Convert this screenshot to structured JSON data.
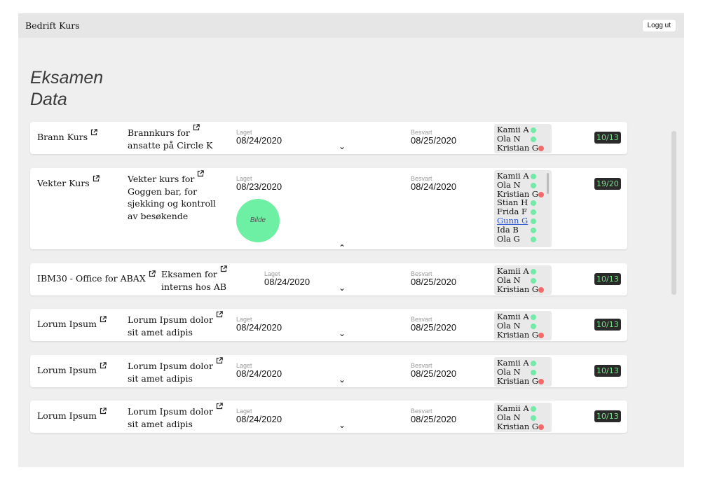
{
  "header": {
    "title": "Bedrift Kurs",
    "logout_label": "Logg ut"
  },
  "page": {
    "title_line1": "Eksamen",
    "title_line2": "Data"
  },
  "cards": [
    {
      "name": "Brann Kurs",
      "desc": [
        "Brannkurs for",
        "ansatte på Circle K"
      ],
      "created_label": "Laget",
      "created": "08/24/2020",
      "answered_label": "Besvart",
      "answered": "08/25/2020",
      "users": [
        {
          "name": "Kamii A",
          "status": "green"
        },
        {
          "name": "Ola N",
          "status": "green"
        },
        {
          "name": "Kristian G",
          "status": "red"
        }
      ],
      "score": "10/13",
      "expand_icon": "chevron-down"
    },
    {
      "name": "Vekter Kurs",
      "desc": [
        "Vekter kurs for",
        "Goggen bar, for",
        "sjekking og kontroll",
        "av besøkende"
      ],
      "created_label": "Laget",
      "created": "08/23/2020",
      "answered_label": "Besvart",
      "answered": "08/24/2020",
      "image_label": "Bilde",
      "users": [
        {
          "name": "Kamii A",
          "status": "green"
        },
        {
          "name": "Ola N",
          "status": "green"
        },
        {
          "name": "Kristian G",
          "status": "red"
        },
        {
          "name": "Stian H",
          "status": "green"
        },
        {
          "name": "Frida F",
          "status": "green"
        },
        {
          "name": "Gunn G",
          "status": "green"
        },
        {
          "name": "Ida B",
          "status": "green"
        },
        {
          "name": "Ola G",
          "status": "green"
        }
      ],
      "score": "19/20",
      "expand_icon": "chevron-up"
    },
    {
      "name": "IBM30 - Office for ABAX",
      "desc": [
        "Eksamen for",
        "interns hos AB"
      ],
      "created_label": "Laget",
      "created": "08/24/2020",
      "answered_label": "Besvart",
      "answered": "08/25/2020",
      "users": [
        {
          "name": "Kamii A",
          "status": "green"
        },
        {
          "name": "Ola N",
          "status": "green"
        },
        {
          "name": "Kristian G",
          "status": "red"
        }
      ],
      "score": "10/13",
      "expand_icon": "chevron-down"
    },
    {
      "name": "Lorum Ipsum",
      "desc": [
        "Lorum Ipsum dolor",
        "sit amet adipis"
      ],
      "created_label": "Laget",
      "created": "08/24/2020",
      "answered_label": "Besvart",
      "answered": "08/25/2020",
      "users": [
        {
          "name": "Kamii A",
          "status": "green"
        },
        {
          "name": "Ola N",
          "status": "green"
        },
        {
          "name": "Kristian G",
          "status": "red"
        }
      ],
      "score": "10/13",
      "expand_icon": "chevron-down"
    },
    {
      "name": "Lorum Ipsum",
      "desc": [
        "Lorum Ipsum dolor",
        "sit amet adipis"
      ],
      "created_label": "Laget",
      "created": "08/24/2020",
      "answered_label": "Besvart",
      "answered": "08/25/2020",
      "users": [
        {
          "name": "Kamii A",
          "status": "green"
        },
        {
          "name": "Ola N",
          "status": "green"
        },
        {
          "name": "Kristian G",
          "status": "red"
        }
      ],
      "score": "10/13",
      "expand_icon": "chevron-down"
    },
    {
      "name": "Lorum Ipsum",
      "desc": [
        "Lorum Ipsum dolor",
        "sit amet adipis"
      ],
      "created_label": "Laget",
      "created": "08/24/2020",
      "answered_label": "Besvart",
      "answered": "08/25/2020",
      "users": [
        {
          "name": "Kamii A",
          "status": "green"
        },
        {
          "name": "Ola N",
          "status": "green"
        },
        {
          "name": "Kristian G",
          "status": "red"
        }
      ],
      "score": "10/13",
      "expand_icon": "chevron-down"
    }
  ],
  "colors": {
    "status_green": "#72eba8",
    "status_red": "#f06b6b",
    "score_bg": "#2a2a2a",
    "score_text": "#7be38c",
    "image_placeholder": "#6ef0a4",
    "link": "#2a56d6"
  }
}
